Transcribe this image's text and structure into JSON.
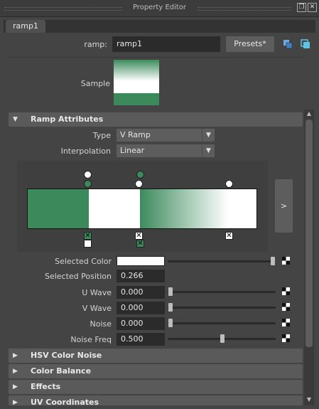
{
  "window": {
    "title": "Property Editor"
  },
  "tab": {
    "label": "ramp1"
  },
  "header": {
    "ramp_label": "ramp:",
    "ramp_name": "ramp1",
    "presets_label": "Presets*"
  },
  "sample": {
    "label": "Sample"
  },
  "ramp_attributes": {
    "header": "Ramp Attributes",
    "type_label": "Type",
    "type_value": "V Ramp",
    "interpolation_label": "Interpolation",
    "interpolation_value": "Linear",
    "expand_button_label": ">",
    "selected_color_label": "Selected Color",
    "selected_color_value": "#ffffff",
    "selected_position_label": "Selected Position",
    "selected_position_value": "0.266",
    "u_wave_label": "U Wave",
    "u_wave_value": "0.000",
    "v_wave_label": "V Wave",
    "v_wave_value": "0.000",
    "noise_label": "Noise",
    "noise_value": "0.000",
    "noise_freq_label": "Noise Freq",
    "noise_freq_value": "0.500"
  },
  "sections": {
    "hsv": "HSV Color Noise",
    "color_balance": "Color Balance",
    "effects": "Effects",
    "uv_coordinates": "UV Coordinates"
  },
  "colors": {
    "ramp_green": "#3c8a5c",
    "ramp_white": "#ffffff"
  },
  "icons": [
    "float-window-icon",
    "close-window-icon",
    "map-to-object-icon",
    "copy-tab-icon",
    "checker-map-icon",
    "triangle-down-icon",
    "triangle-right-icon"
  ]
}
